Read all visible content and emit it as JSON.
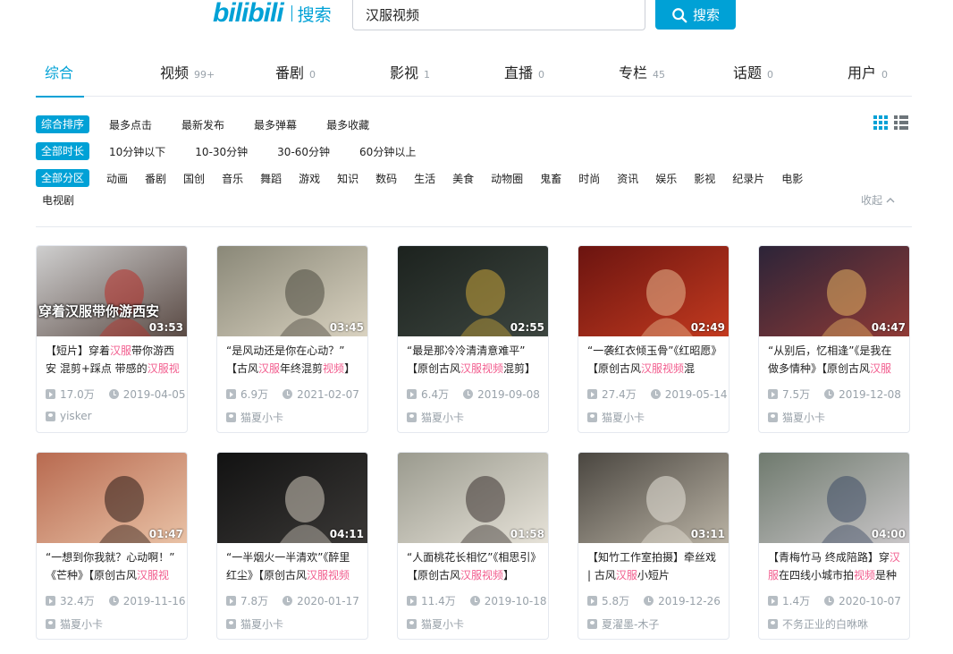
{
  "header": {
    "logo_text": "bilibili",
    "logo_sub": "搜索",
    "search_value": "汉服视频",
    "search_button": "搜索"
  },
  "tabs": [
    {
      "label": "综合",
      "count": ""
    },
    {
      "label": "视频",
      "count": "99+"
    },
    {
      "label": "番剧",
      "count": "0"
    },
    {
      "label": "影视",
      "count": "1"
    },
    {
      "label": "直播",
      "count": "0"
    },
    {
      "label": "专栏",
      "count": "45"
    },
    {
      "label": "话题",
      "count": "0"
    },
    {
      "label": "用户",
      "count": "0"
    }
  ],
  "filters": {
    "sort": {
      "active": "综合排序",
      "options": [
        "最多点击",
        "最新发布",
        "最多弹幕",
        "最多收藏"
      ]
    },
    "duration": {
      "active": "全部时长",
      "options": [
        "10分钟以下",
        "10-30分钟",
        "30-60分钟",
        "60分钟以上"
      ]
    },
    "zone": {
      "active": "全部分区",
      "options": [
        "动画",
        "番剧",
        "国创",
        "音乐",
        "舞蹈",
        "游戏",
        "知识",
        "数码",
        "生活",
        "美食",
        "动物圈",
        "鬼畜",
        "时尚",
        "资讯",
        "娱乐",
        "影视",
        "纪录片",
        "电影"
      ],
      "extra": "电视剧"
    },
    "collapse_label": "收起"
  },
  "videos": [
    {
      "duration": "03:53",
      "title_parts": [
        "【短片】穿着",
        "汉服",
        "带你游西安 混剪+踩点 带感的",
        "汉服视"
      ],
      "views": "17.0万",
      "date": "2019-04-05",
      "uploader": "yisker",
      "thumb_text": "穿着汉服带你游西安",
      "colors": [
        "#cfcfcf",
        "#5a4a44",
        "#b8302a"
      ]
    },
    {
      "duration": "03:45",
      "title_parts": [
        "“是风动还是你在心动？” 【古风",
        "汉服",
        "年终混剪",
        "视频",
        "】"
      ],
      "views": "6.9万",
      "date": "2021-02-07",
      "uploader": "猫夏小卡",
      "thumb_text": "",
      "colors": [
        "#8a8878",
        "#d9d2c0",
        "#4d4a40"
      ]
    },
    {
      "duration": "02:55",
      "title_parts": [
        "“最是那冷冷清清意难平” 【原创古风",
        "汉服视频",
        "混剪】"
      ],
      "views": "6.4万",
      "date": "2019-09-08",
      "uploader": "猫夏小卡",
      "thumb_text": "",
      "colors": [
        "#1c221e",
        "#3d4640",
        "#c8a43a"
      ]
    },
    {
      "duration": "02:49",
      "title_parts": [
        "“一袭红衣倾玉骨”《红昭愿》【原创古风",
        "汉服视频",
        "混"
      ],
      "views": "27.4万",
      "date": "2019-05-14",
      "uploader": "猫夏小卡",
      "thumb_text": "",
      "colors": [
        "#6b1410",
        "#c33a1f",
        "#e7b88f"
      ]
    },
    {
      "duration": "04:47",
      "title_parts": [
        "“从别后，忆相逢”《是我在做多情种》【原创古风",
        "汉服"
      ],
      "views": "7.5万",
      "date": "2019-12-08",
      "uploader": "猫夏小卡",
      "thumb_text": "",
      "colors": [
        "#2c2438",
        "#8f3a36",
        "#e5b262"
      ]
    },
    {
      "duration": "01:47",
      "title_parts": [
        "“一想到你我就？心动啊！” 《芒种》【原创古风",
        "汉服视"
      ],
      "views": "32.4万",
      "date": "2019-11-16",
      "uploader": "猫夏小卡",
      "thumb_text": "",
      "colors": [
        "#b86a50",
        "#e9c2a6",
        "#2a1a16"
      ]
    },
    {
      "duration": "04:11",
      "title_parts": [
        "“一半烟火一半清欢”《醉里红尘》【原创古风",
        "汉服视频"
      ],
      "views": "7.8万",
      "date": "2020-01-17",
      "uploader": "猫夏小卡",
      "thumb_text": "",
      "colors": [
        "#121212",
        "#3a3836",
        "#cfc8bc"
      ]
    },
    {
      "duration": "01:58",
      "title_parts": [
        "“人面桃花长相忆”《相思引》【原创古风",
        "汉服视频",
        "】"
      ],
      "views": "11.4万",
      "date": "2019-10-18",
      "uploader": "猫夏小卡",
      "thumb_text": "",
      "colors": [
        "#9a9a8e",
        "#e6e2d8",
        "#3a3230"
      ]
    },
    {
      "duration": "03:11",
      "title_parts": [
        "【知竹工作室拍摄】牵丝戏 | 古风",
        "汉服",
        "小短片"
      ],
      "views": "5.8万",
      "date": "2019-12-26",
      "uploader": "夏濯墨-木子",
      "thumb_text": "",
      "colors": [
        "#4a4640",
        "#b9b2a4",
        "#e8e4da"
      ]
    },
    {
      "duration": "04:00",
      "title_parts": [
        "【青梅竹马 终成陪路】穿",
        "汉服",
        "在四线小城市拍",
        "视频",
        "是种"
      ],
      "views": "1.4万",
      "date": "2020-10-07",
      "uploader": "不务正业的白咻咻",
      "thumb_text": "",
      "colors": [
        "#6f7a6e",
        "#c9c6c8",
        "#3c4a64"
      ]
    }
  ]
}
